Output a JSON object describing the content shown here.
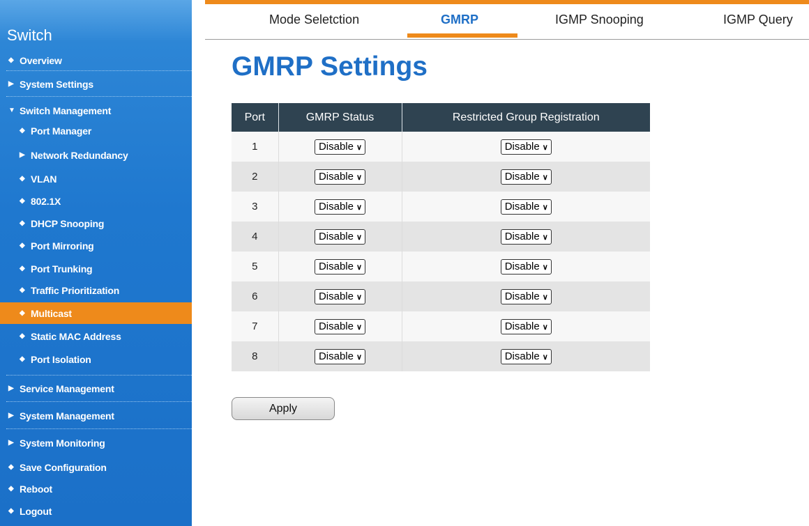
{
  "sidebar": {
    "title": "Switch",
    "items": [
      {
        "label": "Overview",
        "glyph": "◆"
      },
      {
        "label": "System Settings",
        "glyph": "▶"
      },
      {
        "label": "Switch Management",
        "glyph": "▼"
      },
      {
        "label": "Port Manager",
        "glyph": "◆"
      },
      {
        "label": "Network Redundancy",
        "glyph": "▶"
      },
      {
        "label": "VLAN",
        "glyph": "◆"
      },
      {
        "label": "802.1X",
        "glyph": "◆"
      },
      {
        "label": "DHCP Snooping",
        "glyph": "◆"
      },
      {
        "label": "Port Mirroring",
        "glyph": "◆"
      },
      {
        "label": "Port Trunking",
        "glyph": "◆"
      },
      {
        "label": "Traffic Prioritization",
        "glyph": "◆"
      },
      {
        "label": "Multicast",
        "glyph": "◆"
      },
      {
        "label": "Static MAC Address",
        "glyph": "◆"
      },
      {
        "label": "Port Isolation",
        "glyph": "◆"
      },
      {
        "label": "Service Management",
        "glyph": "▶"
      },
      {
        "label": "System Management",
        "glyph": "▶"
      },
      {
        "label": "System Monitoring",
        "glyph": "▶"
      },
      {
        "label": "Save Configuration",
        "glyph": "◆"
      },
      {
        "label": "Reboot",
        "glyph": "◆"
      },
      {
        "label": "Logout",
        "glyph": "◆"
      }
    ]
  },
  "tabs": [
    {
      "label": "Mode Seletction"
    },
    {
      "label": "GMRP"
    },
    {
      "label": "IGMP Snooping"
    },
    {
      "label": "IGMP Query"
    }
  ],
  "page": {
    "title": "GMRP Settings"
  },
  "table": {
    "headers": [
      "Port",
      "GMRP Status",
      "Restricted Group Registration"
    ],
    "rows": [
      {
        "port": "1",
        "gmrp_status": "Disable",
        "restricted": "Disable"
      },
      {
        "port": "2",
        "gmrp_status": "Disable",
        "restricted": "Disable"
      },
      {
        "port": "3",
        "gmrp_status": "Disable",
        "restricted": "Disable"
      },
      {
        "port": "4",
        "gmrp_status": "Disable",
        "restricted": "Disable"
      },
      {
        "port": "5",
        "gmrp_status": "Disable",
        "restricted": "Disable"
      },
      {
        "port": "6",
        "gmrp_status": "Disable",
        "restricted": "Disable"
      },
      {
        "port": "7",
        "gmrp_status": "Disable",
        "restricted": "Disable"
      },
      {
        "port": "8",
        "gmrp_status": "Disable",
        "restricted": "Disable"
      }
    ]
  },
  "apply_label": "Apply",
  "colors": {
    "accent": "#ee8a1b",
    "sidebar": "#1b70c8",
    "title": "#1f6fc6",
    "header": "#2f4351"
  }
}
